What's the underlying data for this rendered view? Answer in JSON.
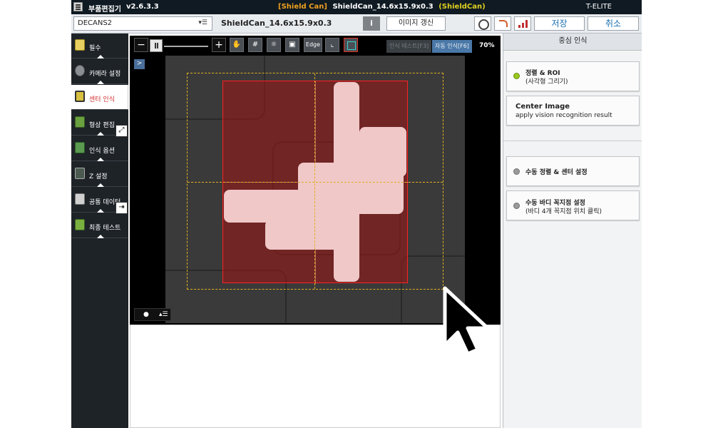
{
  "titlebar": {
    "app_name": "부품편집기",
    "version": "v2.6.3.3",
    "part_bracket_open": "[Shield Can]",
    "part_name": "ShieldCan_14.6x15.9x0.3",
    "part_bracket_close": "(ShieldCan)",
    "brand": "T-ELITE"
  },
  "toolbar": {
    "model_select": "DECANS2",
    "part_name": "ShieldCan_14.6x15.9x0.3",
    "info_label": "i",
    "refresh_label": "이미지 갱신",
    "save_label": "저장",
    "cancel_label": "취소"
  },
  "sidebar": {
    "items": [
      {
        "label": "필수",
        "icon": "checklist-icon"
      },
      {
        "label": "카메라 설정",
        "icon": "camera-gear-icon"
      },
      {
        "label": "센터 인식",
        "icon": "target-chip-icon"
      },
      {
        "label": "형상 편집",
        "icon": "shape-edit-icon"
      },
      {
        "label": "인식 옵션",
        "icon": "recognition-option-icon"
      },
      {
        "label": "Z 설정",
        "icon": "z-setting-icon"
      },
      {
        "label": "공통 데이터",
        "icon": "common-data-icon"
      },
      {
        "label": "최종 테스트",
        "icon": "final-test-icon"
      }
    ],
    "active_index": 2
  },
  "viewer": {
    "zoom_minus": "−",
    "zoom_plus": "+",
    "edge_label": "Edge",
    "manual_test_label": "인식 테스트[F3]",
    "auto_recog_label": "자동 인식[F6]",
    "zoom_level": "70%",
    "panel_toggle": ">",
    "display_dot": "●",
    "display_list": "▴☰"
  },
  "right_panel": {
    "title": "중심 인식",
    "buttons": [
      {
        "title": "정렬 & ROI",
        "subtitle": "(사각형 그리기)",
        "led": "green"
      },
      {
        "title": "Center Image",
        "subtitle": "apply vision recognition result",
        "led": "none"
      },
      {
        "title": "수동 정렬 & 센터 설정",
        "subtitle": "",
        "led": "gray"
      },
      {
        "title": "수동 바디 꼭지점 설정",
        "subtitle": "(바디 4개 꼭지점 위치 클릭)",
        "led": "gray"
      }
    ]
  },
  "colors": {
    "titlebar_bg": "#0f1a22",
    "accent_blue": "#1a6fb0",
    "roi_red": "#ff2020",
    "roi_dashed": "#e0b020",
    "active_tab_text": "#d03030"
  }
}
